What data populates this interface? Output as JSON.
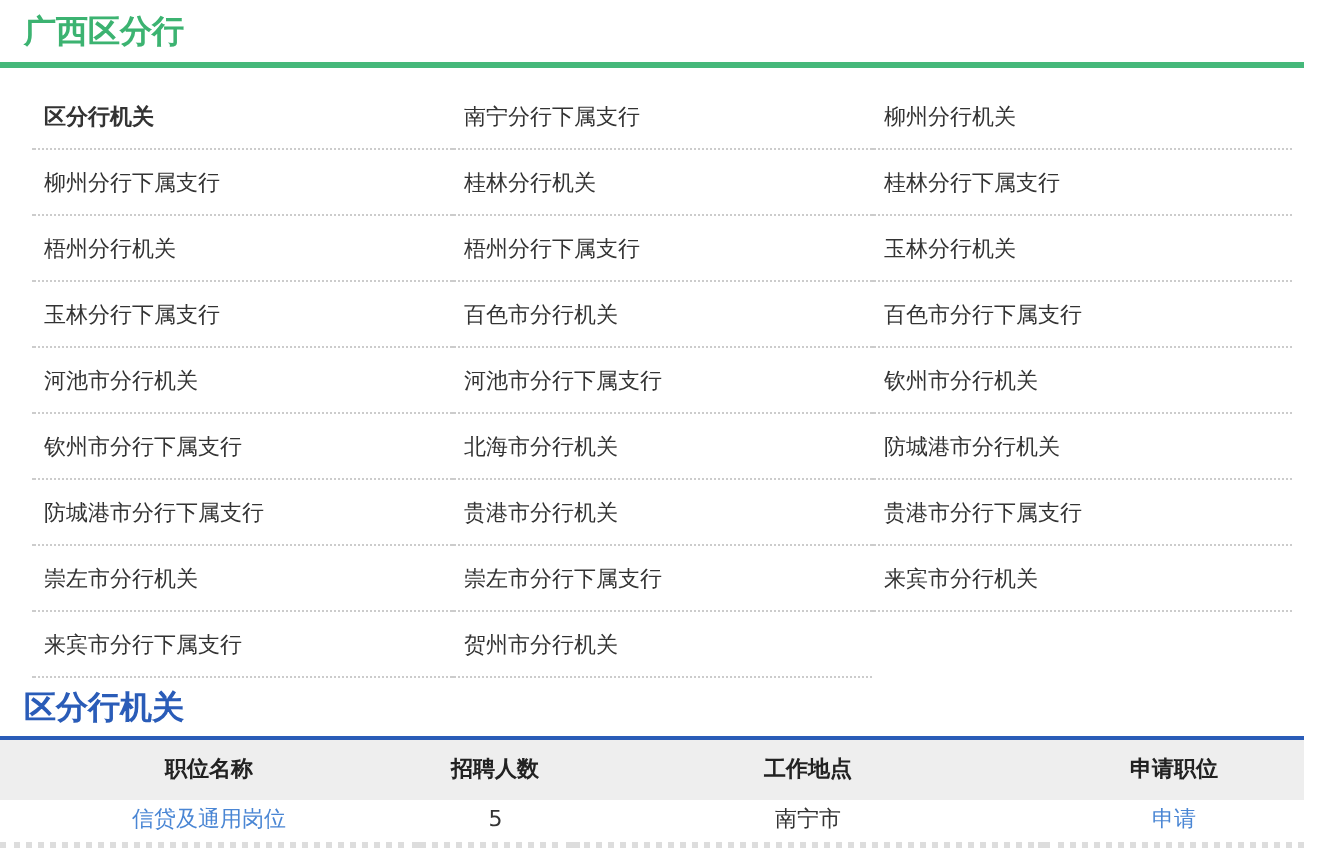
{
  "region_title": "广西区分行",
  "branches": [
    {
      "label": "区分行机关",
      "selected": true
    },
    {
      "label": "南宁分行下属支行",
      "selected": false
    },
    {
      "label": "柳州分行机关",
      "selected": false
    },
    {
      "label": "柳州分行下属支行",
      "selected": false
    },
    {
      "label": "桂林分行机关",
      "selected": false
    },
    {
      "label": "桂林分行下属支行",
      "selected": false
    },
    {
      "label": "梧州分行机关",
      "selected": false
    },
    {
      "label": "梧州分行下属支行",
      "selected": false
    },
    {
      "label": "玉林分行机关",
      "selected": false
    },
    {
      "label": "玉林分行下属支行",
      "selected": false
    },
    {
      "label": "百色市分行机关",
      "selected": false
    },
    {
      "label": "百色市分行下属支行",
      "selected": false
    },
    {
      "label": "河池市分行机关",
      "selected": false
    },
    {
      "label": "河池市分行下属支行",
      "selected": false
    },
    {
      "label": "钦州市分行机关",
      "selected": false
    },
    {
      "label": "钦州市分行下属支行",
      "selected": false
    },
    {
      "label": "北海市分行机关",
      "selected": false
    },
    {
      "label": "防城港市分行机关",
      "selected": false
    },
    {
      "label": "防城港市分行下属支行",
      "selected": false
    },
    {
      "label": "贵港市分行机关",
      "selected": false
    },
    {
      "label": "贵港市分行下属支行",
      "selected": false
    },
    {
      "label": "崇左市分行机关",
      "selected": false
    },
    {
      "label": "崇左市分行下属支行",
      "selected": false
    },
    {
      "label": "来宾市分行机关",
      "selected": false
    },
    {
      "label": "来宾市分行下属支行",
      "selected": false
    },
    {
      "label": "贺州市分行机关",
      "selected": false
    }
  ],
  "section_title": "区分行机关",
  "table": {
    "columns": [
      "职位名称",
      "招聘人数",
      "工作地点",
      "申请职位"
    ],
    "rows": [
      {
        "position": "信贷及通用岗位",
        "count": "5",
        "location": "南宁市",
        "apply": "申请"
      }
    ]
  }
}
